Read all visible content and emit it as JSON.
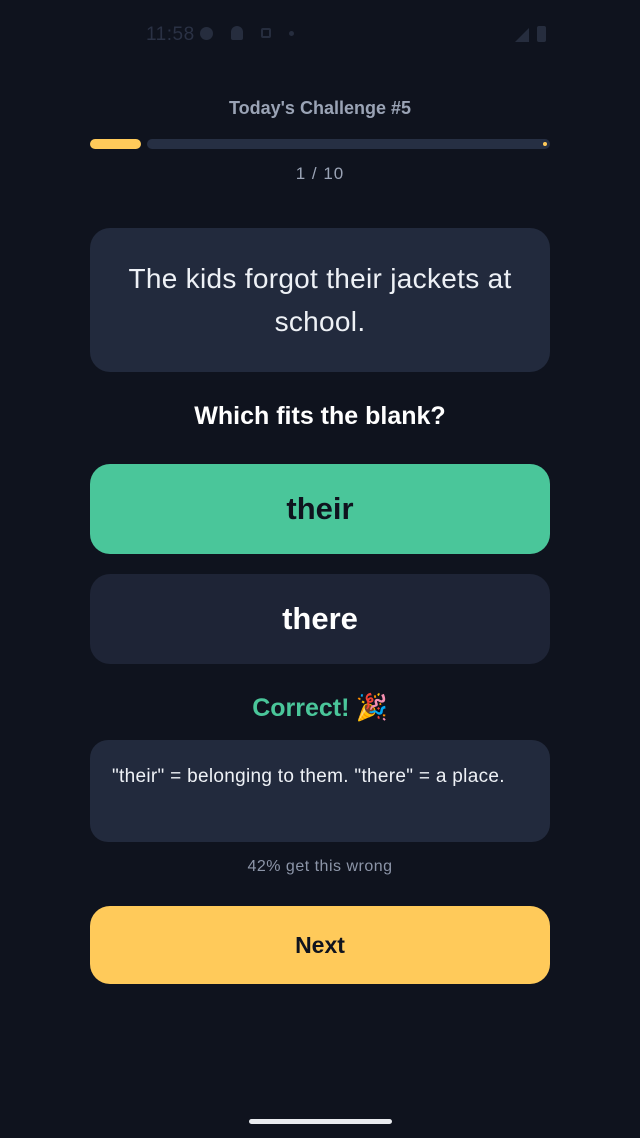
{
  "status_bar": {
    "time": "11:58"
  },
  "header": {
    "challenge_title": "Today's Challenge #5"
  },
  "progress": {
    "current": 1,
    "total": 10,
    "label": "1 / 10"
  },
  "question": {
    "sentence": "The kids forgot their jackets at school.",
    "prompt": "Which fits the blank?"
  },
  "options": [
    {
      "label": "their",
      "state": "correct"
    },
    {
      "label": "there",
      "state": "default"
    }
  ],
  "feedback": {
    "result": "Correct!",
    "result_icon": "🎉",
    "explanation": "\"their\" = belonging to them. \"there\" = a place.",
    "stat": "42% get this wrong"
  },
  "actions": {
    "next_label": "Next"
  },
  "colors": {
    "background": "#0f131e",
    "accent_yellow": "#ffca5a",
    "correct_green": "#4ac69a",
    "card": "#222a3d"
  }
}
